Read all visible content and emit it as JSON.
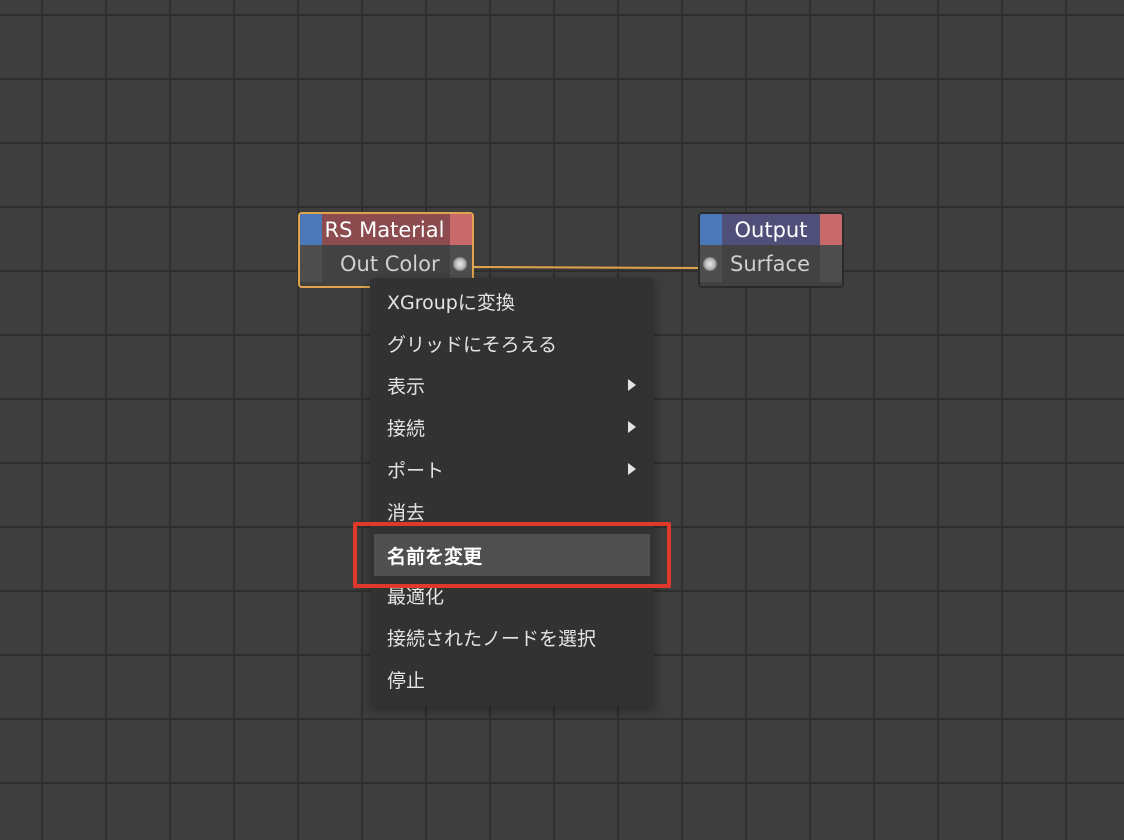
{
  "nodes": {
    "rs_material": {
      "title": "RS Material",
      "port_label": "Out Color"
    },
    "output": {
      "title": "Output",
      "port_label": "Surface"
    }
  },
  "context_menu": {
    "items": [
      {
        "label": "XGroupに変換",
        "submenu": false
      },
      {
        "label": "グリッドにそろえる",
        "submenu": false
      },
      {
        "label": "表示",
        "submenu": true
      },
      {
        "label": "接続",
        "submenu": true
      },
      {
        "label": "ポート",
        "submenu": true
      },
      {
        "label": "消去",
        "submenu": false
      },
      {
        "label": "名前を変更",
        "submenu": false,
        "highlighted": true
      },
      {
        "label": "最適化",
        "submenu": false
      },
      {
        "label": "接続されたノードを選択",
        "submenu": false
      },
      {
        "label": "停止",
        "submenu": false
      }
    ]
  },
  "colors": {
    "header_blue": "#4a78b8",
    "rs_header_red": "#8c4b4f",
    "header_red_strip": "#c96a6a",
    "output_header": "#4f4f7a",
    "selection_orange": "#e0a44e",
    "wire": "#e0a44e",
    "annotation_red": "#e0392b"
  },
  "icons": {
    "submenu_arrow": "chevron-right-icon",
    "port": "port-dot-icon"
  }
}
